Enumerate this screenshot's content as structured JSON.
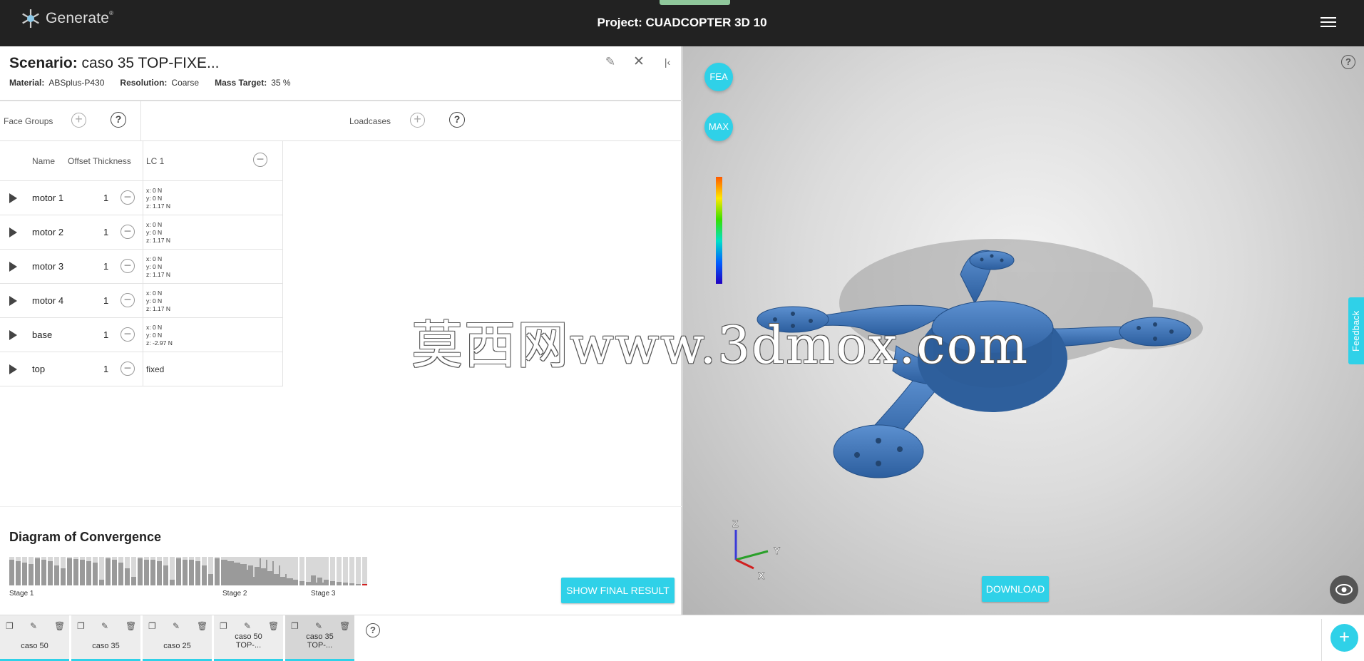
{
  "app": {
    "logo_text": "Generate",
    "logo_sup": "®",
    "project_title": "Project: CUADCOPTER 3D 10"
  },
  "scenario": {
    "label": "Scenario:",
    "name": "caso 35 TOP-FIXE...",
    "material_label": "Material:",
    "material": "ABSplus-P430",
    "resolution_label": "Resolution:",
    "resolution": "Coarse",
    "mass_label": "Mass Target:",
    "mass": "35 %"
  },
  "groups": {
    "face_groups": "Face Groups",
    "loadcases": "Loadcases"
  },
  "table": {
    "headers": {
      "name": "Name",
      "offset": "Offset Thickness",
      "lc": "LC 1"
    },
    "rows": [
      {
        "name": "motor 1",
        "offset": "1",
        "lc": [
          "x: 0 N",
          "y: 0 N",
          "z: 1.17 N"
        ]
      },
      {
        "name": "motor 2",
        "offset": "1",
        "lc": [
          "x: 0 N",
          "y: 0 N",
          "z: 1.17 N"
        ]
      },
      {
        "name": "motor 3",
        "offset": "1",
        "lc": [
          "x: 0 N",
          "y: 0 N",
          "z: 1.17 N"
        ]
      },
      {
        "name": "motor 4",
        "offset": "1",
        "lc": [
          "x: 0 N",
          "y: 0 N",
          "z: 1.17 N"
        ]
      },
      {
        "name": "base",
        "offset": "1",
        "lc": [
          "x: 0 N",
          "y: 0 N",
          "z: -2.97 N"
        ]
      },
      {
        "name": "top",
        "offset": "1",
        "lc_text": "fixed"
      }
    ]
  },
  "convergence": {
    "title": "Diagram of Convergence",
    "stages": [
      {
        "label": "Stage 1",
        "levels": [
          0.9,
          0.85,
          0.8,
          0.75,
          0.95,
          0.9,
          0.85,
          0.7,
          0.6,
          0.95,
          0.92,
          0.9,
          0.85,
          0.8,
          0.2,
          0.95,
          0.9,
          0.8,
          0.6,
          0.3,
          0.95,
          0.9,
          0.9,
          0.85,
          0.7,
          0.2,
          0.95,
          0.9,
          0.9,
          0.85,
          0.7,
          0.4,
          0.95,
          0.9,
          0.85,
          0.8,
          0.75,
          0.55,
          0.3,
          0.95,
          0.9,
          0.85,
          0.7,
          0.4,
          0.25
        ]
      },
      {
        "label": "Stage 2",
        "levels": [
          0.9,
          0.85,
          0.8,
          0.75,
          0.7,
          0.65,
          0.6,
          0.5,
          0.4,
          0.3,
          0.25,
          0.2,
          0.15,
          0.12,
          0.1,
          0.1
        ]
      },
      {
        "label": "Stage 3",
        "levels": [
          0.35,
          0.28,
          0.2,
          0.15,
          0.12,
          0.1,
          0.08,
          0.06,
          0.05
        ]
      }
    ]
  },
  "buttons": {
    "show_final": "SHOW FINAL RESULT",
    "download": "DOWNLOAD",
    "fea": "FEA",
    "max": "MAX",
    "feedback": "Feedback"
  },
  "viewport": {
    "watermark": "莫西网www.3dmox.com",
    "axis_x": "X",
    "axis_y": "Y",
    "axis_z": "Z"
  },
  "tabs": [
    {
      "label": "caso 50"
    },
    {
      "label": "caso 35"
    },
    {
      "label": "caso 25"
    },
    {
      "label": "caso 50 TOP-..."
    },
    {
      "label": "caso 35 TOP-..."
    }
  ],
  "colors": {
    "accent": "#2fd1e8",
    "topbar": "#222222",
    "model": "#3a72b8"
  }
}
